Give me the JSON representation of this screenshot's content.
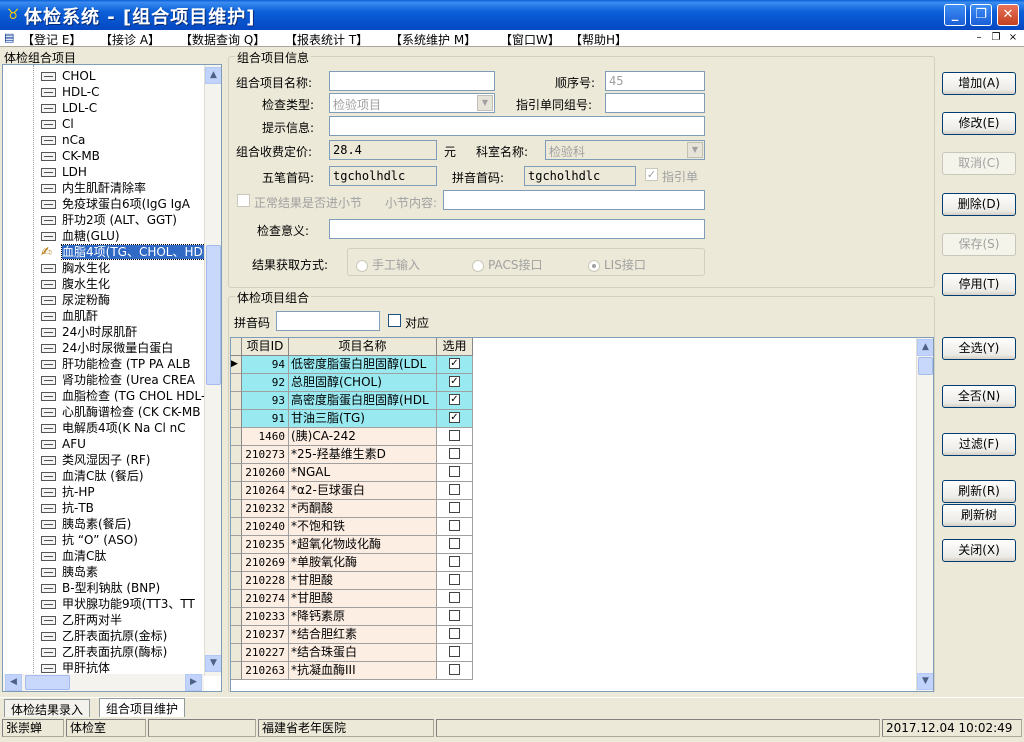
{
  "window": {
    "title": "体检系统 - [组合项目维护]",
    "minimize": "_",
    "maximize": "❐",
    "close": "✕"
  },
  "menu": {
    "items": [
      "【登记 E】",
      "【接诊 A】",
      "【数据查询 Q】",
      "【报表统计 T】",
      "【系统维护 M】",
      "【窗口W】",
      "【帮助H】"
    ],
    "mdi_min": "–",
    "mdi_restore": "❐",
    "mdi_close": "×"
  },
  "tree": {
    "title": "体检组合项目",
    "items": [
      "CHOL",
      "HDL-C",
      "LDL-C",
      "Cl",
      "nCa",
      "CK-MB",
      "LDH",
      "内生肌酐清除率",
      "免疫球蛋白6项(IgG IgA",
      "肝功2项 (ALT、GGT)",
      "血糖(GLU)",
      "血脂4项(TG、CHOL、HDL",
      "胸水生化",
      "腹水生化",
      "尿淀粉酶",
      "血肌酐",
      "24小时尿肌酐",
      "24小时尿微量白蛋白",
      "肝功能检查 (TP PA ALB",
      "肾功能检查 (Urea CREA",
      "血脂检查 (TG CHOL HDL-",
      "心肌酶谱检查 (CK CK-MB",
      "电解质4项(K Na Cl nC",
      "AFU",
      "类风湿因子 (RF)",
      "血清C肽 (餐后)",
      "抗-HP",
      "抗-TB",
      "胰岛素(餐后)",
      "抗 “O” (ASO)",
      "血清C肽",
      "胰岛素",
      "B-型利钠肽 (BNP)",
      "甲状腺功能9项(TT3、TT",
      "乙肝两对半",
      "乙肝表面抗原(金标)",
      "乙肝表面抗原(酶标)",
      "甲肝抗体"
    ],
    "selected_index": 11
  },
  "form": {
    "group_title": "组合项目信息",
    "name_label": "组合项目名称:",
    "name_value": "",
    "order_label": "顺序号:",
    "order_value": "45",
    "type_label": "检查类型:",
    "type_value": "检验项目",
    "guide_label": "指引单同组号:",
    "guide_value": "",
    "tip_label": "提示信息:",
    "tip_value": "",
    "price_label": "组合收费定价:",
    "price_value": "28.4",
    "price_unit": "元",
    "dept_label": "科室名称:",
    "dept_value": "检验科",
    "wubi_label": "五笔首码:",
    "wubi_value": "tgcholhdlc",
    "pinyin_label": "拼音首码:",
    "pinyin_value": "tgcholhdlc",
    "guide_check_label": "指引单",
    "normal_label": "正常结果是否进小节",
    "section_label": "小节内容:",
    "section_value": "",
    "meaning_label": "检查意义:",
    "meaning_value": "",
    "result_label": "结果获取方式:",
    "result_options": [
      "手工输入",
      "PACS接口",
      "LIS接口"
    ]
  },
  "combo": {
    "group_title": "体检项目组合",
    "pinyin_label": "拼音码",
    "pinyin_value": "",
    "match_label": "对应"
  },
  "grid": {
    "headers": [
      "项目ID",
      "项目名称",
      "选用"
    ],
    "rows": [
      {
        "id": "94",
        "name": "低密度脂蛋白胆固醇(LDL",
        "checked": true
      },
      {
        "id": "92",
        "name": "总胆固醇(CHOL)",
        "checked": true
      },
      {
        "id": "93",
        "name": "高密度脂蛋白胆固醇(HDL",
        "checked": true
      },
      {
        "id": "91",
        "name": "甘油三脂(TG)",
        "checked": true
      },
      {
        "id": "1460",
        "name": "(胰)CA-242",
        "checked": false
      },
      {
        "id": "210273",
        "name": "*25-羟基维生素D",
        "checked": false
      },
      {
        "id": "210260",
        "name": "*NGAL",
        "checked": false
      },
      {
        "id": "210264",
        "name": "*α2-巨球蛋白",
        "checked": false
      },
      {
        "id": "210232",
        "name": "*丙酮酸",
        "checked": false
      },
      {
        "id": "210240",
        "name": "*不饱和铁",
        "checked": false
      },
      {
        "id": "210235",
        "name": "*超氧化物歧化酶",
        "checked": false
      },
      {
        "id": "210269",
        "name": "*单胺氧化酶",
        "checked": false
      },
      {
        "id": "210228",
        "name": "*甘胆酸",
        "checked": false
      },
      {
        "id": "210274",
        "name": "*甘胆酸",
        "checked": false
      },
      {
        "id": "210233",
        "name": "*降钙素原",
        "checked": false
      },
      {
        "id": "210237",
        "name": "*结合胆红素",
        "checked": false
      },
      {
        "id": "210227",
        "name": "*结合珠蛋白",
        "checked": false
      },
      {
        "id": "210263",
        "name": "*抗凝血酶III",
        "checked": false
      }
    ]
  },
  "buttons": {
    "add": "增加(A)",
    "edit": "修改(E)",
    "cancel": "取消(C)",
    "delete": "删除(D)",
    "save": "保存(S)",
    "disable": "停用(T)",
    "select_all": "全选(Y)",
    "select_none": "全否(N)",
    "filter": "过滤(F)",
    "refresh": "刷新(R)",
    "refresh_tree": "刷新树",
    "close": "关闭(X)"
  },
  "tabs": [
    "体检结果录入",
    "组合项目维护"
  ],
  "status": {
    "user": "张崇蝉",
    "dept": "体检室",
    "hospital": "福建省老年医院",
    "datetime": "2017.12.04 10:02:49"
  },
  "colors": {
    "title_bar": "#0a5fd8",
    "selected_row": "#99e9f1",
    "normal_row": "#fdeee4",
    "tree_selection": "#316ac5"
  }
}
